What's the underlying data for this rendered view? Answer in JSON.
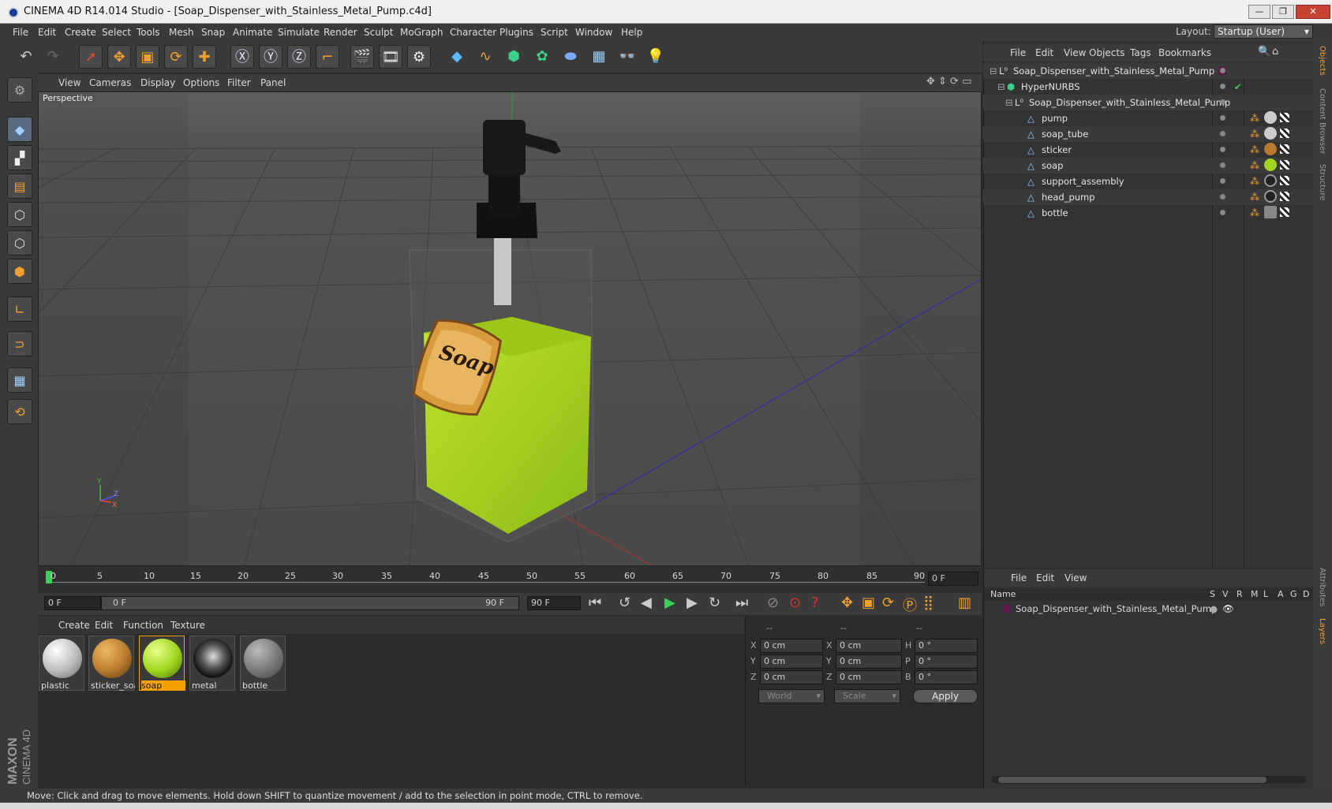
{
  "window": {
    "title": "CINEMA 4D R14.014 Studio - [Soap_Dispenser_with_Stainless_Metal_Pump.c4d]"
  },
  "menubar": {
    "items": [
      "File",
      "Edit",
      "Create",
      "Select",
      "Tools",
      "Mesh",
      "Snap",
      "Animate",
      "Simulate",
      "Render",
      "Sculpt",
      "MoGraph",
      "Character",
      "Plugins",
      "Script",
      "Window",
      "Help"
    ]
  },
  "layout": {
    "label": "Layout:",
    "value": "Startup (User)"
  },
  "viewport": {
    "menu": [
      "View",
      "Cameras",
      "Display",
      "Options",
      "Filter",
      "Panel"
    ],
    "camera_label": "Perspective",
    "sticker_text": "Soap",
    "axis_y": "Y",
    "axis_z": "Z",
    "axis_x": "X"
  },
  "timeline": {
    "ticks": [
      "0",
      "5",
      "10",
      "15",
      "20",
      "25",
      "30",
      "35",
      "40",
      "45",
      "50",
      "55",
      "60",
      "65",
      "70",
      "75",
      "80",
      "85",
      "90"
    ],
    "current_frame": "0 F",
    "start_field": "0 F",
    "range_start": "0 F",
    "range_end": "90 F",
    "end_field": "90 F"
  },
  "materials": {
    "menu": [
      "Create",
      "Edit",
      "Function",
      "Texture"
    ],
    "items": [
      {
        "label": "plastic",
        "color": "#d8d8d8"
      },
      {
        "label": "sticker_soa",
        "color": "#b87a2e"
      },
      {
        "label": "soap",
        "color": "#9fd51e"
      },
      {
        "label": "metal",
        "color": "#3a3a3a"
      },
      {
        "label": "bottle",
        "color": "#8a8a8a"
      }
    ],
    "selected": "soap"
  },
  "coordinates": {
    "headers": [
      "--",
      "--",
      "--"
    ],
    "rows": [
      {
        "a": "X",
        "av": "0 cm",
        "b": "X",
        "bv": "0 cm",
        "c": "H",
        "cv": "0 °"
      },
      {
        "a": "Y",
        "av": "0 cm",
        "b": "Y",
        "bv": "0 cm",
        "c": "P",
        "cv": "0 °"
      },
      {
        "a": "Z",
        "av": "0 cm",
        "b": "Z",
        "bv": "0 cm",
        "c": "B",
        "cv": "0 °"
      }
    ],
    "space": "World",
    "mode": "Scale",
    "apply": "Apply"
  },
  "objects": {
    "menu": [
      "File",
      "Edit",
      "View",
      "Objects",
      "Tags",
      "Bookmarks"
    ],
    "tree": [
      {
        "name": "Soap_Dispenser_with_Stainless_Metal_Pump"
      },
      {
        "name": "HyperNURBS"
      },
      {
        "name": "Soap_Dispenser_with_Stainless_Metal_Pump"
      },
      {
        "name": "pump"
      },
      {
        "name": "soap_tube"
      },
      {
        "name": "sticker"
      },
      {
        "name": "soap"
      },
      {
        "name": "support_assembly"
      },
      {
        "name": "head_pump"
      },
      {
        "name": "bottle"
      }
    ]
  },
  "layers": {
    "menu": [
      "File",
      "Edit",
      "View"
    ],
    "columns": [
      "Name",
      "S",
      "V",
      "R",
      "M",
      "L",
      "A",
      "G",
      "D"
    ],
    "rows": [
      "Soap_Dispenser_with_Stainless_Metal_Pump"
    ]
  },
  "side_tabs": [
    "Objects",
    "Content Browser",
    "Structure",
    "Attributes",
    "Layers"
  ],
  "branding": {
    "line1": "MAXON",
    "line2": "CINEMA 4D"
  },
  "status": "Move: Click and drag to move elements. Hold down SHIFT to quantize movement / add to the selection in point mode, CTRL to remove.",
  "colors": {
    "accent": "#f0a030",
    "selection": "#f5a000",
    "soap_green": "#9fd51e"
  }
}
